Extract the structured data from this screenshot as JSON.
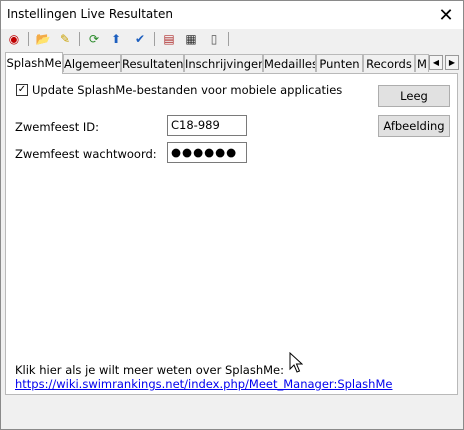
{
  "window": {
    "title": "Instellingen Live Resultaten",
    "close_glyph": "✕"
  },
  "toolbar": {
    "buttons": [
      {
        "icon": "record-icon",
        "glyph": "◉",
        "color": "#c00000"
      },
      {
        "icon": "open-folder-icon",
        "glyph": "📂",
        "color": "#c8a000"
      },
      {
        "icon": "edit-folder-icon",
        "glyph": "✎",
        "color": "#c8a000"
      },
      {
        "icon": "refresh-icon",
        "glyph": "⟳",
        "color": "#2a8a2a"
      },
      {
        "icon": "upload-icon",
        "glyph": "⬆",
        "color": "#1d5fbf"
      },
      {
        "icon": "check-tools-icon",
        "glyph": "✔",
        "color": "#1d5fbf"
      },
      {
        "icon": "properties-icon",
        "glyph": "▤",
        "color": "#b03030"
      },
      {
        "icon": "settings-list-icon",
        "glyph": "▦",
        "color": "#333333"
      },
      {
        "icon": "document-icon",
        "glyph": "▯",
        "color": "#555555"
      }
    ]
  },
  "tabs": [
    "SplashMe",
    "Algemeen",
    "Resultaten",
    "Inschrijvingen",
    "Medailles",
    "Punten",
    "Records",
    "M"
  ],
  "tab_scroll": {
    "left": "◀",
    "right": "▶"
  },
  "splashme": {
    "checkbox_checked": true,
    "checkbox_mark": "✓",
    "checkbox_label": "Update SplashMe-bestanden voor mobiele applicaties",
    "btn_clear": "Leeg",
    "btn_image": "Afbeelding",
    "meet_id_label": "Zwemfeest ID:",
    "meet_id_value": "C18-989",
    "password_label": "Zwemfeest wachtwoord:",
    "password_value": "●●●●●●",
    "info_text": "Klik hier als je wilt meer weten over SplashMe:",
    "info_link": "https://wiki.swimrankings.net/index.php/Meet_Manager:SplashMe"
  }
}
